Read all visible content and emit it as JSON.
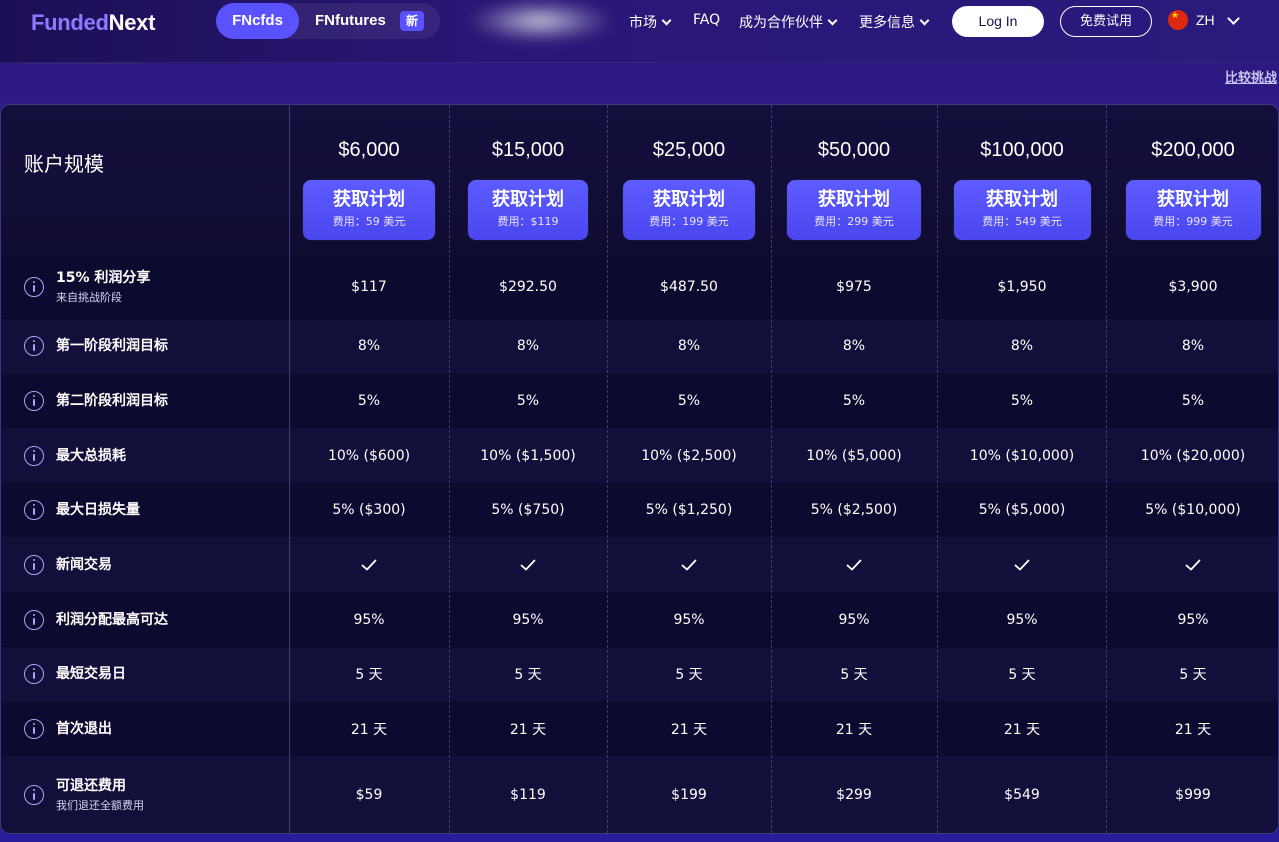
{
  "nav": {
    "logo_part1": "Funded",
    "logo_part2": "Next",
    "tab_active": "FNcfds",
    "tab_futures": "FNfutures",
    "new_badge": "新",
    "links": [
      "市场",
      "FAQ",
      "成为合作伙伴",
      "更多信息"
    ],
    "login": "Log In",
    "free_trial": "免费试用",
    "lang": "ZH"
  },
  "compare_link": "比较挑战",
  "table": {
    "size_title": "账户规模",
    "plans": [
      {
        "price": "$6,000",
        "button": "获取计划",
        "fee": "费用：59 美元"
      },
      {
        "price": "$15,000",
        "button": "获取计划",
        "fee": "费用：$119"
      },
      {
        "price": "$25,000",
        "button": "获取计划",
        "fee": "费用：199 美元"
      },
      {
        "price": "$50,000",
        "button": "获取计划",
        "fee": "费用：299 美元"
      },
      {
        "price": "$100,000",
        "button": "获取计划",
        "fee": "费用：549 美元"
      },
      {
        "price": "$200,000",
        "button": "获取计划",
        "fee": "费用：999 美元"
      }
    ],
    "rows": [
      {
        "label": "15% 利润分享",
        "sub": "来自挑战阶段",
        "values": [
          "$117",
          "$292.50",
          "$487.50",
          "$975",
          "$1,950",
          "$3,900"
        ]
      },
      {
        "label": "第一阶段利润目标",
        "sub": "",
        "values": [
          "8%",
          "8%",
          "8%",
          "8%",
          "8%",
          "8%"
        ]
      },
      {
        "label": "第二阶段利润目标",
        "sub": "",
        "values": [
          "5%",
          "5%",
          "5%",
          "5%",
          "5%",
          "5%"
        ]
      },
      {
        "label": "最大总损耗",
        "sub": "",
        "values": [
          "10% ($600)",
          "10% ($1,500)",
          "10% ($2,500)",
          "10% ($5,000)",
          "10% ($10,000)",
          "10% ($20,000)"
        ]
      },
      {
        "label": "最大日损失量",
        "sub": "",
        "values": [
          "5% ($300)",
          "5% ($750)",
          "5% ($1,250)",
          "5% ($2,500)",
          "5% ($5,000)",
          "5% ($10,000)"
        ]
      },
      {
        "label": "新闻交易",
        "sub": "",
        "values": [
          "✓",
          "✓",
          "✓",
          "✓",
          "✓",
          "✓"
        ]
      },
      {
        "label": "利润分配最高可达",
        "sub": "",
        "values": [
          "95%",
          "95%",
          "95%",
          "95%",
          "95%",
          "95%"
        ]
      },
      {
        "label": "最短交易日",
        "sub": "",
        "values": [
          "5 天",
          "5 天",
          "5 天",
          "5 天",
          "5 天",
          "5 天"
        ]
      },
      {
        "label": "首次退出",
        "sub": "",
        "values": [
          "21 天",
          "21 天",
          "21 天",
          "21 天",
          "21 天",
          "21 天"
        ]
      },
      {
        "label": "可退还费用",
        "sub": "我们退还全额费用",
        "values": [
          "$59",
          "$119",
          "$199",
          "$299",
          "$549",
          "$999"
        ]
      }
    ]
  },
  "colors": {
    "accent": "#5b52ff",
    "card_bg": "#0c0a2e",
    "row_alt": "#120f3a",
    "icon": "#a9a4ff"
  }
}
